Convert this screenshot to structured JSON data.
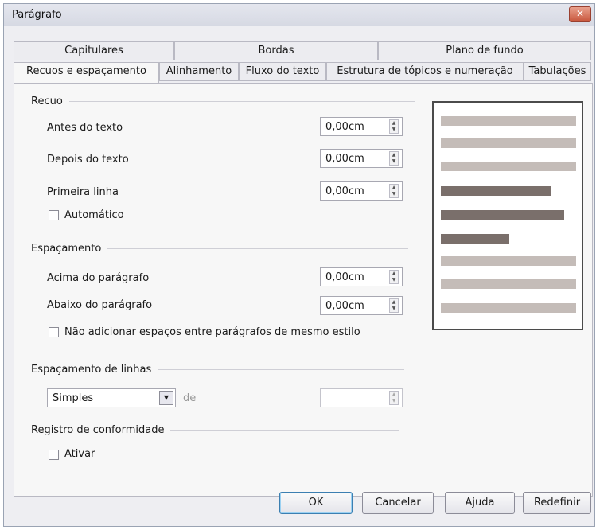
{
  "window": {
    "title": "Parágrafo",
    "close_glyph": "✕"
  },
  "tabs_back": [
    "Capitulares",
    "Bordas",
    "Plano de fundo"
  ],
  "tabs_front": [
    "Recuos e espaçamento",
    "Alinhamento",
    "Fluxo do texto",
    "Estrutura de tópicos e numeração",
    "Tabulações"
  ],
  "active_tab": "Recuos e espaçamento",
  "recuo": {
    "title": "Recuo",
    "before_label": "Antes do texto",
    "before_value": "0,00cm",
    "after_label": "Depois do texto",
    "after_value": "0,00cm",
    "first_label": "Primeira linha",
    "first_value": "0,00cm",
    "auto_label": "Automático",
    "auto_checked": false
  },
  "espacamento": {
    "title": "Espaçamento",
    "above_label": "Acima do parágrafo",
    "above_value": "0,00cm",
    "below_label": "Abaixo do parágrafo",
    "below_value": "0,00cm",
    "noadd_label": "Não adicionar espaços entre parágrafos de mesmo estilo",
    "noadd_checked": false
  },
  "linhas": {
    "title": "Espaçamento de linhas",
    "select_value": "Simples",
    "de_label": "de",
    "de_value": ""
  },
  "registro": {
    "title": "Registro de conformidade",
    "ativar_label": "Ativar",
    "ativar_checked": false
  },
  "preview": {
    "light_color": "#c4bcb8",
    "dark_color": "#7a6f6b"
  },
  "buttons": {
    "ok": "OK",
    "cancel": "Cancelar",
    "help": "Ajuda",
    "reset": "Redefinir"
  }
}
